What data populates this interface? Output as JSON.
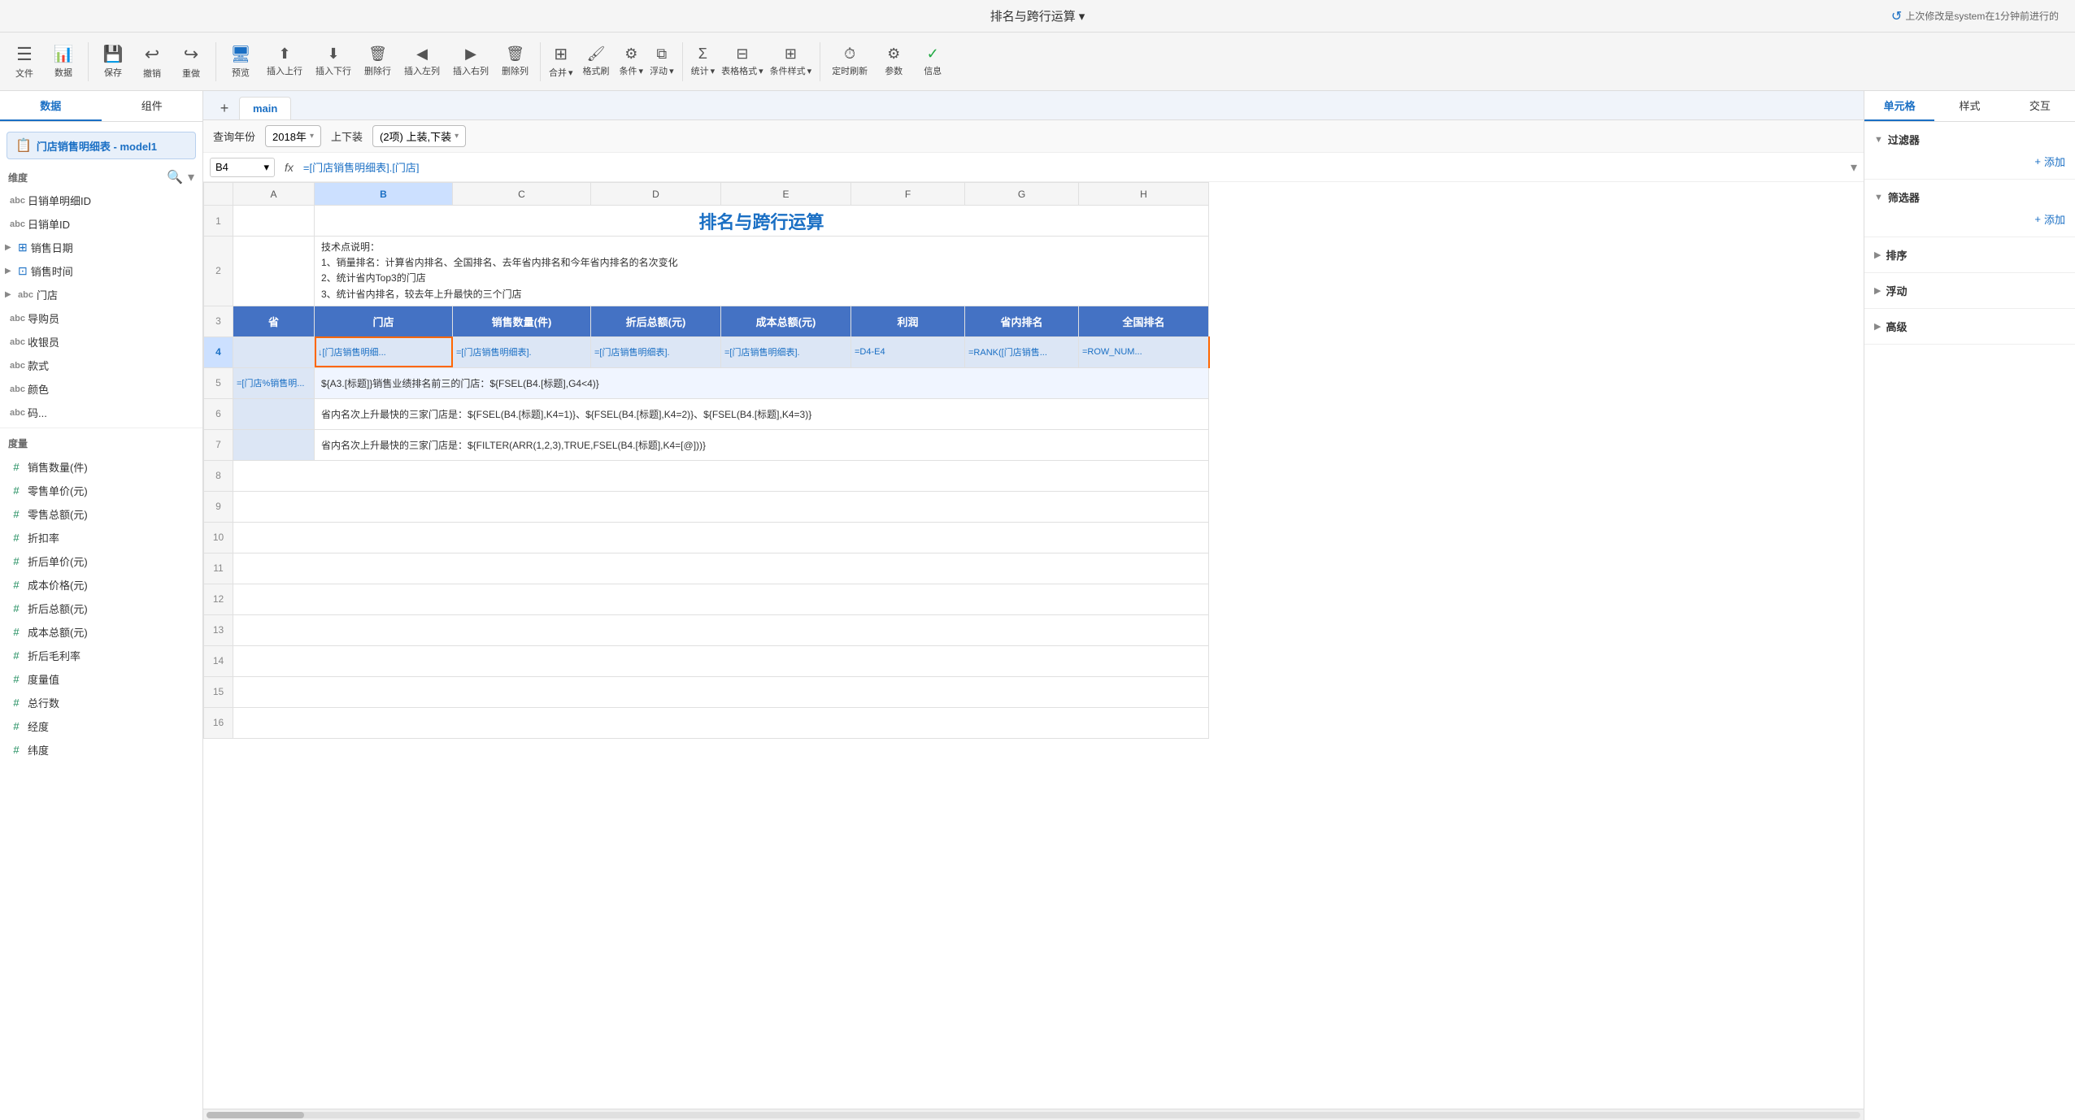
{
  "titleBar": {
    "title": "排名与跨行运算",
    "dropdownIcon": "▾",
    "lastModified": "上次修改是system在1分钟前进行的"
  },
  "toolbar": {
    "items": [
      {
        "id": "menu",
        "icon": "☰",
        "label": "文件"
      },
      {
        "id": "data",
        "icon": "📊",
        "label": "数据"
      },
      {
        "id": "save",
        "icon": "💾",
        "label": "保存"
      },
      {
        "id": "undo",
        "icon": "↩",
        "label": "撤销"
      },
      {
        "id": "redo",
        "icon": "↪",
        "label": "重做"
      },
      {
        "id": "preview",
        "icon": "👁",
        "label": "预览"
      },
      {
        "id": "insert-up",
        "icon": "⬆",
        "label": "插入上行"
      },
      {
        "id": "insert-down",
        "icon": "⬇",
        "label": "插入下行"
      },
      {
        "id": "delete-row",
        "icon": "✕",
        "label": "删除行"
      },
      {
        "id": "insert-left",
        "icon": "◀",
        "label": "插入左列"
      },
      {
        "id": "insert-right",
        "icon": "▶",
        "label": "插入右列"
      },
      {
        "id": "delete-col",
        "icon": "✕",
        "label": "删除列"
      },
      {
        "id": "merge",
        "icon": "⊞",
        "label": "合并"
      },
      {
        "id": "format",
        "icon": "🖌",
        "label": "格式刷"
      },
      {
        "id": "condition",
        "icon": "⚙",
        "label": "条件"
      },
      {
        "id": "float",
        "icon": "⧉",
        "label": "浮动"
      },
      {
        "id": "stat",
        "icon": "Σ",
        "label": "统计"
      },
      {
        "id": "table-format",
        "icon": "⊟",
        "label": "表格格式"
      },
      {
        "id": "cond-style",
        "icon": "⊞",
        "label": "条件样式"
      },
      {
        "id": "timer",
        "icon": "⏱",
        "label": "定时刷新"
      },
      {
        "id": "param",
        "icon": "⚙",
        "label": "参数"
      },
      {
        "id": "info",
        "icon": "✓",
        "label": "信息"
      }
    ]
  },
  "leftPanel": {
    "tabs": [
      "数据",
      "组件"
    ],
    "activeTab": "数据",
    "dataset": {
      "icon": "📋",
      "name": "门店销售明细表 - model1"
    },
    "dimensions": {
      "label": "维度",
      "fields": [
        {
          "icon": "abc",
          "type": "dim",
          "name": "日销单明细ID"
        },
        {
          "icon": "abc",
          "type": "dim",
          "name": "日销单ID"
        },
        {
          "icon": "table",
          "type": "group",
          "name": "销售日期",
          "expandable": true
        },
        {
          "icon": "table",
          "type": "group",
          "name": "销售时间",
          "expandable": true
        },
        {
          "icon": "abc",
          "type": "dim",
          "name": "门店",
          "expandable": true
        },
        {
          "icon": "abc",
          "type": "dim",
          "name": "导购员"
        },
        {
          "icon": "abc",
          "type": "dim",
          "name": "收银员"
        },
        {
          "icon": "abc",
          "type": "dim",
          "name": "款式"
        },
        {
          "icon": "abc",
          "type": "dim",
          "name": "颜色"
        },
        {
          "icon": "abc",
          "type": "dim",
          "name": "码..."
        }
      ]
    },
    "measures": {
      "label": "度量",
      "fields": [
        {
          "name": "销售数量(件)"
        },
        {
          "name": "零售单价(元)"
        },
        {
          "name": "零售总额(元)"
        },
        {
          "name": "折扣率"
        },
        {
          "name": "折后单价(元)"
        },
        {
          "name": "成本价格(元)"
        },
        {
          "name": "折后总额(元)"
        },
        {
          "name": "成本总额(元)"
        },
        {
          "name": "折后毛利率"
        },
        {
          "name": "度量值"
        },
        {
          "name": "总行数"
        },
        {
          "name": "经度"
        },
        {
          "name": "纬度"
        }
      ]
    }
  },
  "tabBar": {
    "addLabel": "+",
    "tabs": [
      "main"
    ]
  },
  "filterBar": {
    "label": "查询年份",
    "yearValue": "2018年",
    "label2": "上下装",
    "value2": "(2项) 上装,下装"
  },
  "formulaBar": {
    "cellRef": "B4",
    "expandIcon": "▾",
    "formulaIcon": "fx",
    "formula": "=[门店销售明细表].[门店]",
    "expandArrow": "▾"
  },
  "grid": {
    "colHeaders": [
      "",
      "A",
      "B",
      "C",
      "D",
      "E",
      "F",
      "G",
      "H"
    ],
    "rows": [
      {
        "rowNum": "1",
        "cells": [
          {
            "col": "A",
            "content": "",
            "span": 8,
            "type": "title",
            "text": "排名与跨行运算"
          }
        ]
      },
      {
        "rowNum": "2",
        "cells": [
          {
            "col": "A",
            "content": "",
            "type": "empty"
          },
          {
            "col": "B",
            "span": 7,
            "type": "info",
            "text": "技术点说明：\n1、销量排名：计算省内排名、全国排名、去年省内排名和今年省内排名的名次变化\n2、统计省内Top3的门店\n3、统计省内排名，较去年上升最快的三个门店"
          }
        ]
      },
      {
        "rowNum": "3",
        "cells": [
          {
            "col": "A",
            "content": "省",
            "type": "header"
          },
          {
            "col": "B",
            "content": "门店",
            "type": "header"
          },
          {
            "col": "C",
            "content": "销售数量(件)",
            "type": "header"
          },
          {
            "col": "D",
            "content": "折后总额(元)",
            "type": "header"
          },
          {
            "col": "E",
            "content": "成本总额(元)",
            "type": "header"
          },
          {
            "col": "F",
            "content": "利润",
            "type": "header"
          },
          {
            "col": "G",
            "content": "省内排名",
            "type": "header"
          },
          {
            "col": "H",
            "content": "全国排名",
            "type": "header"
          }
        ]
      },
      {
        "rowNum": "4",
        "cells": [
          {
            "col": "A",
            "content": "",
            "type": "light-blue"
          },
          {
            "col": "B",
            "content": "↓[门店销售明细...",
            "type": "formula light-blue selected"
          },
          {
            "col": "C",
            "content": "=[门店销售明细表].",
            "type": "formula light-blue"
          },
          {
            "col": "D",
            "content": "=[门店销售明细表].",
            "type": "formula light-blue"
          },
          {
            "col": "E",
            "content": "=[门店销售明细表].",
            "type": "formula light-blue"
          },
          {
            "col": "F",
            "content": "=D4-E4",
            "type": "formula light-blue"
          },
          {
            "col": "G",
            "content": "=RANK([门店销售...",
            "type": "formula light-blue"
          },
          {
            "col": "H",
            "content": "=ROW_NUM...",
            "type": "formula light-blue orange-border"
          }
        ]
      },
      {
        "rowNum": "5",
        "cells": [
          {
            "col": "A",
            "content": "=[门店%销售明...",
            "type": "formula light-blue"
          },
          {
            "col": "B",
            "span": 7,
            "type": "formula-text",
            "text": "${A3.[标题]}销售业绩排名前三的门店：${FSEL(B4.[标题],G4<4)}"
          }
        ]
      },
      {
        "rowNum": "6",
        "cells": [
          {
            "col": "A",
            "content": "",
            "type": "light-blue"
          },
          {
            "col": "B",
            "span": 7,
            "type": "formula-text",
            "text": "省内名次上升最快的三家门店是：${FSEL(B4.[标题],K4=1)}、${FSEL(B4.[标题],K4=2)}、${FSEL(B4.[标题],K4=3)}"
          }
        ]
      },
      {
        "rowNum": "7",
        "cells": [
          {
            "col": "A",
            "content": "",
            "type": "light-blue"
          },
          {
            "col": "B",
            "span": 7,
            "type": "formula-text",
            "text": "省内名次上升最快的三家门店是：${FILTER(ARR(1,2,3),TRUE,FSEL(B4.[标题],K4=[@]))}"
          }
        ]
      }
    ]
  },
  "rightPanel": {
    "tabs": [
      "单元格",
      "样式",
      "交互"
    ],
    "activeTab": "单元格",
    "sections": [
      {
        "id": "filter",
        "label": "过滤器",
        "collapsed": false,
        "addLabel": "+ 添加"
      },
      {
        "id": "screener",
        "label": "筛选器",
        "collapsed": false,
        "addLabel": "+ 添加"
      },
      {
        "id": "sort",
        "label": "排序",
        "collapsed": true
      },
      {
        "id": "float",
        "label": "浮动",
        "collapsed": true
      },
      {
        "id": "advanced",
        "label": "高级",
        "collapsed": true
      }
    ]
  }
}
